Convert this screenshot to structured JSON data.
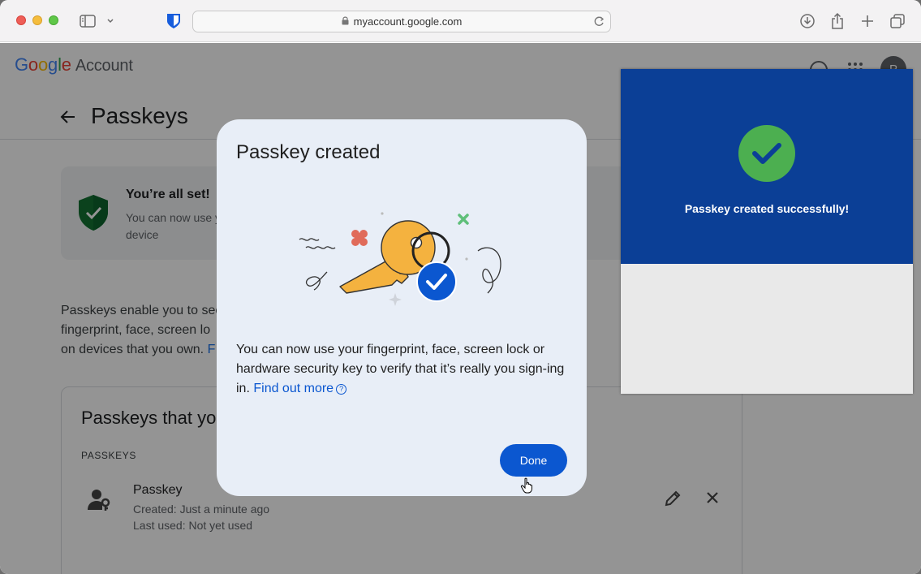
{
  "browser": {
    "url": "myaccount.google.com",
    "icons": [
      "sidebar-icon",
      "chevron-down-icon",
      "bitwarden-icon",
      "lock-icon",
      "reload-icon",
      "download-icon",
      "share-icon",
      "plus-icon",
      "tabs-icon"
    ]
  },
  "header": {
    "logo_letters": [
      "G",
      "o",
      "o",
      "g",
      "l",
      "e"
    ],
    "logo_suffix": "Account",
    "avatar_letter": "P"
  },
  "page": {
    "title": "Passkeys",
    "allset_title": "You’re all set!",
    "allset_desc": "You can now use y device",
    "intro": "Passkeys enable you to sec fingerprint, face, screen lo on devices that you own.",
    "intro_link": "F",
    "card_title": "Passkeys that you",
    "column_label": "PASSKEYS",
    "passkey": {
      "name": "Passkey",
      "created": "Created: Just a minute ago",
      "last_used": "Last used: Not yet used"
    }
  },
  "dialog": {
    "title": "Passkey created",
    "body": "You can now use your fingerprint, face, screen lock or hardware security key to verify that it’s really you sign-ing in.",
    "link": "Find out more",
    "help_glyph": "?",
    "done_label": "Done"
  },
  "popup": {
    "message": "Passkey created successfully!",
    "colors": {
      "top": "#0b3f96",
      "check": "#4caf50"
    }
  }
}
